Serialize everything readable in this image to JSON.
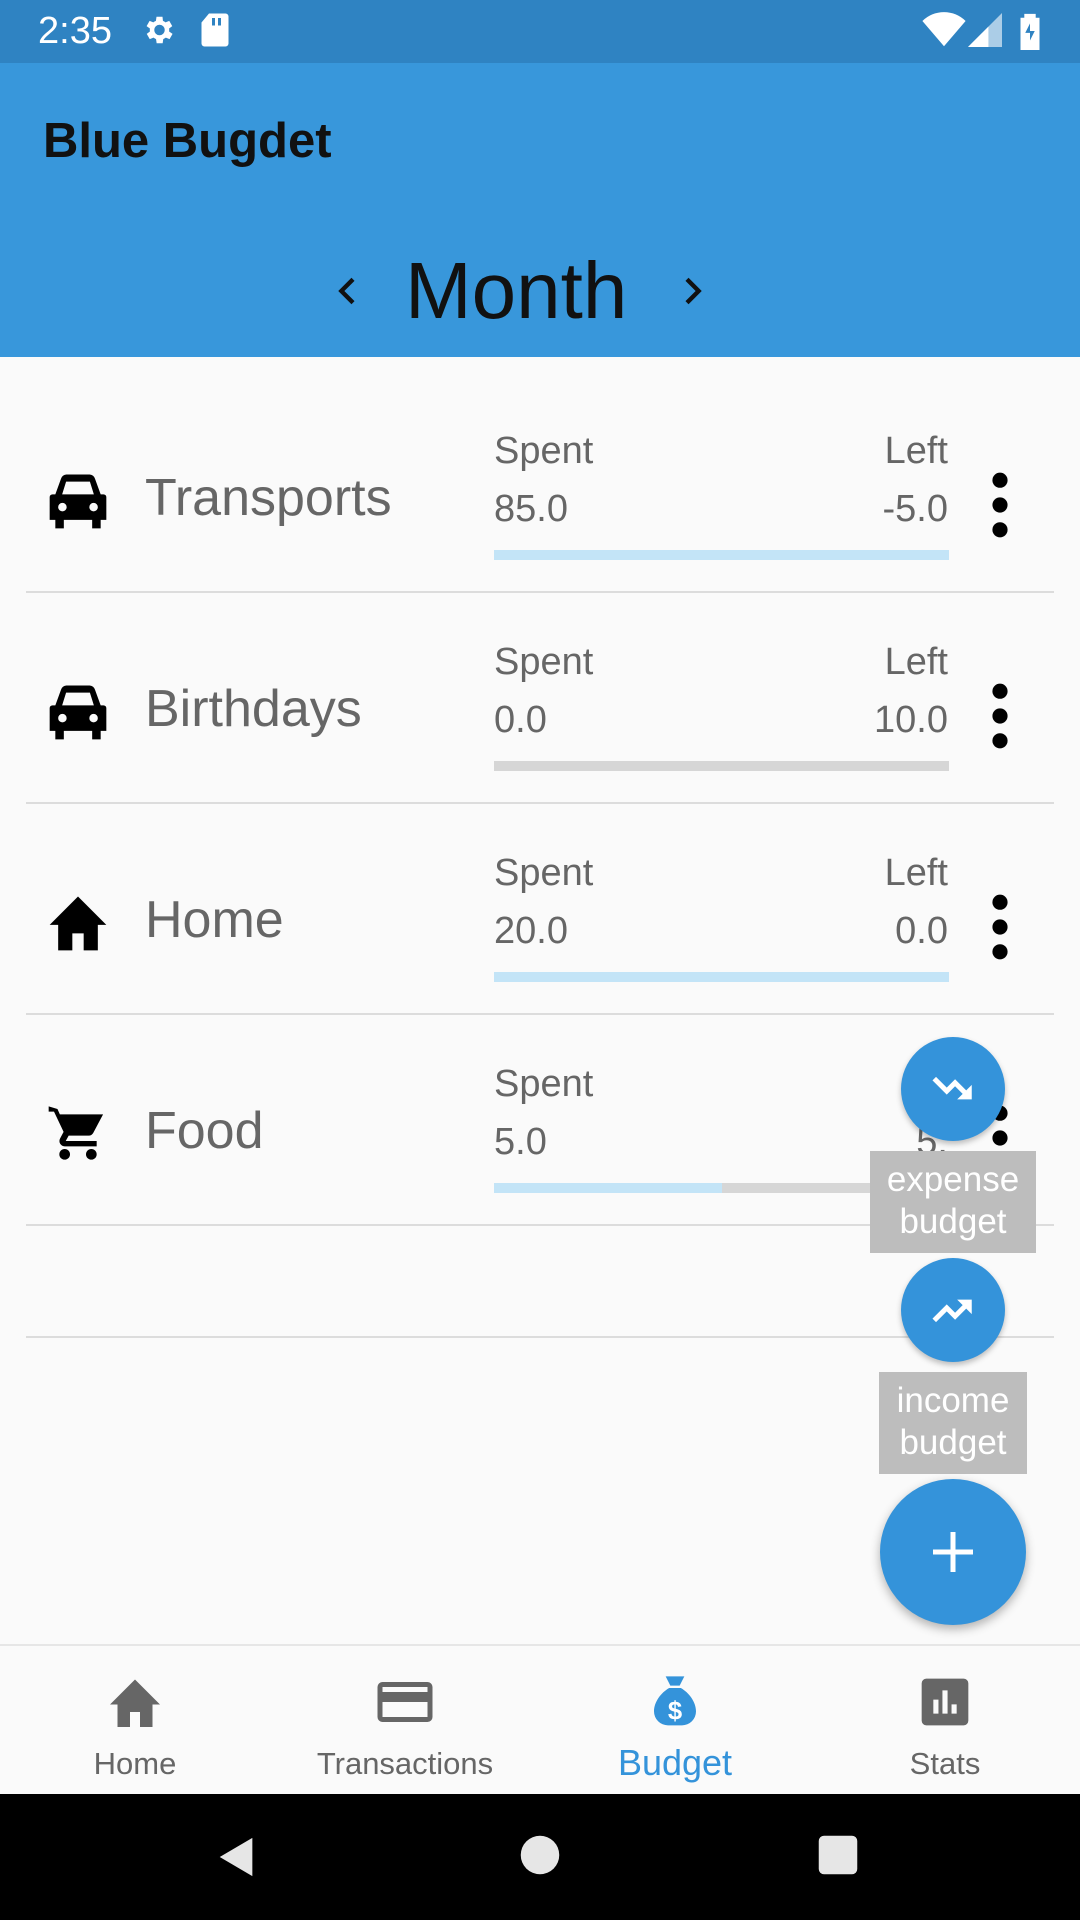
{
  "status_bar": {
    "time": "2:35"
  },
  "app_bar": {
    "title": "Blue Bugdet",
    "period_label": "Month"
  },
  "budgets": [
    {
      "name": "Transports",
      "icon": "car-icon",
      "spent_label": "Spent",
      "left_label": "Left",
      "spent": "85.0",
      "left": "-5.0",
      "progress": 1.0
    },
    {
      "name": "Birthdays",
      "icon": "car-icon",
      "spent_label": "Spent",
      "left_label": "Left",
      "spent": "0.0",
      "left": "10.0",
      "progress": 0.0
    },
    {
      "name": "Home",
      "icon": "home-icon",
      "spent_label": "Spent",
      "left_label": "Left",
      "spent": "20.0",
      "left": "0.0",
      "progress": 1.0
    },
    {
      "name": "Food",
      "icon": "cart-icon",
      "spent_label": "Spent",
      "left_label": "Le",
      "spent": "5.0",
      "left": "5.",
      "progress": 0.5
    }
  ],
  "fab_menu": {
    "expense_label": "expense budget",
    "expense_line1": "expense",
    "expense_line2": "budget",
    "income_label": "income budget",
    "income_line1": "income",
    "income_line2": "budget"
  },
  "bottom_nav": {
    "items": [
      {
        "label": "Home",
        "icon": "home-icon"
      },
      {
        "label": "Transactions",
        "icon": "credit-card-icon"
      },
      {
        "label": "Budget",
        "icon": "money-bag-icon",
        "active": true
      },
      {
        "label": "Stats",
        "icon": "bar-chart-icon"
      }
    ]
  },
  "colors": {
    "status_bar": "#2f83c2",
    "app_bar": "#3897db",
    "accent": "#3493da",
    "progress_fill": "#c3e4f7",
    "progress_track": "#d6d6d6"
  }
}
